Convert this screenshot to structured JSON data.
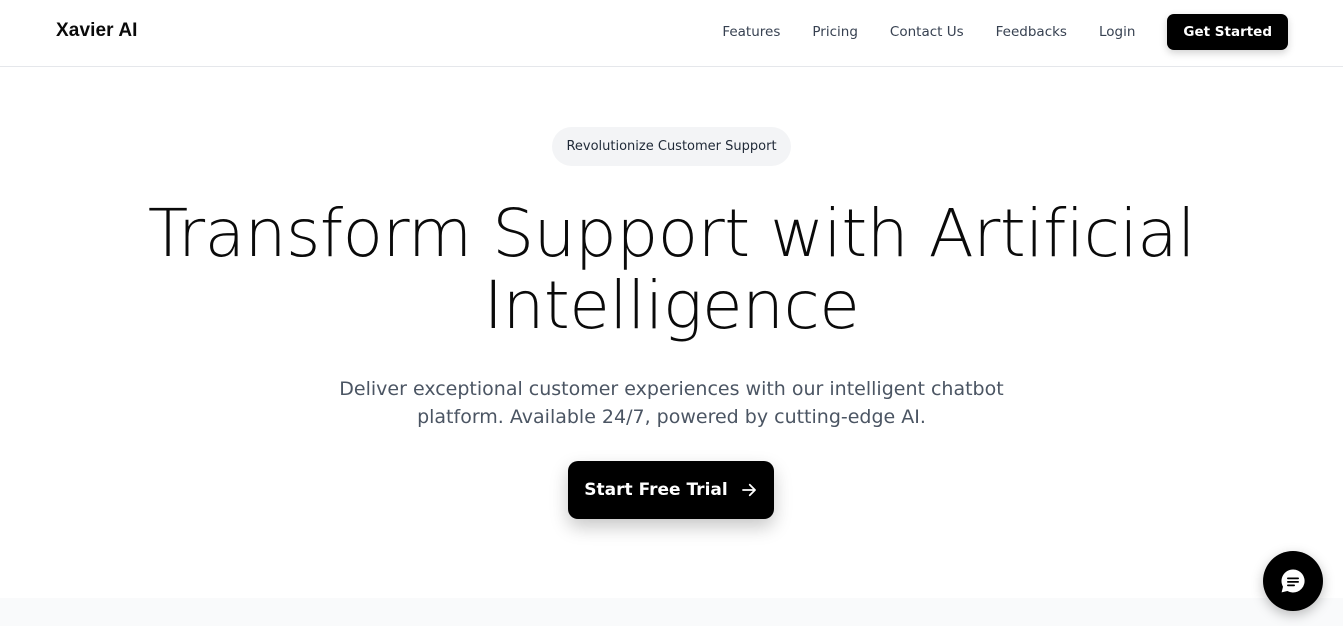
{
  "header": {
    "brand": "Xavier AI",
    "nav": {
      "features": "Features",
      "pricing": "Pricing",
      "contact": "Contact Us",
      "feedbacks": "Feedbacks",
      "login": "Login"
    },
    "cta_label": "Get Started"
  },
  "hero": {
    "badge": "Revolutionize Customer Support",
    "headline_line1": "Transform Support with Artificial",
    "headline_line2": "Intelligence",
    "subtext_line1": "Deliver exceptional customer experiences with our intelligent chatbot",
    "subtext_line2": "platform. Available 24/7, powered by cutting-edge AI.",
    "cta_label": "Start Free Trial",
    "cta_icon": "arrow-right-icon"
  },
  "chat_widget": {
    "icon": "chat-bubble-icon"
  },
  "colors": {
    "primary": "#000000",
    "badge_bg": "#f3f4f6",
    "text_muted": "#4b5563",
    "nav_text": "#374151"
  }
}
